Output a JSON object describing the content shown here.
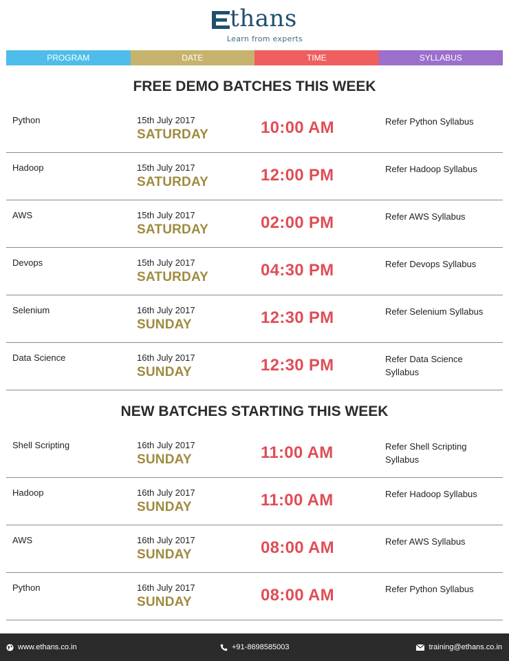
{
  "brand": {
    "name": "thans",
    "tagline": "Learn from experts"
  },
  "header": {
    "program": "PROGRAM",
    "date": "DATE",
    "time": "TIME",
    "syllabus": "SYLLABUS",
    "colors": {
      "program": "#4fbde9",
      "date": "#c7b36d",
      "time": "#ef5f5f",
      "syllabus": "#9b6fcc"
    }
  },
  "demo": {
    "title": "FREE DEMO BATCHES THIS WEEK",
    "rows": [
      {
        "program": "Python",
        "date": "15th July 2017",
        "day": "SATURDAY",
        "time": "10:00 AM",
        "syllabus": "Refer Python Syllabus"
      },
      {
        "program": "Hadoop",
        "date": "15th July 2017",
        "day": "SATURDAY",
        "time": "12:00 PM",
        "syllabus": "Refer Hadoop Syllabus"
      },
      {
        "program": "AWS",
        "date": "15th July 2017",
        "day": "SATURDAY",
        "time": "02:00 PM",
        "syllabus": "Refer AWS Syllabus"
      },
      {
        "program": "Devops",
        "date": "15th July 2017",
        "day": "SATURDAY",
        "time": "04:30 PM",
        "syllabus": "Refer Devops Syllabus"
      },
      {
        "program": "Selenium",
        "date": "16th July 2017",
        "day": "SUNDAY",
        "time": "12:30 PM",
        "syllabus": "Refer Selenium Syllabus"
      },
      {
        "program": "Data Science",
        "date": "16th July 2017",
        "day": "SUNDAY",
        "time": "12:30 PM",
        "syllabus": "Refer Data Science Syllabus"
      }
    ]
  },
  "new_batches": {
    "title": "NEW BATCHES STARTING THIS WEEK",
    "rows": [
      {
        "program": "Shell Scripting",
        "date": "16th July 2017",
        "day": "SUNDAY",
        "time": "11:00 AM",
        "syllabus": "Refer Shell Scripting Syllabus"
      },
      {
        "program": "Hadoop",
        "date": "16th July 2017",
        "day": "SUNDAY",
        "time": "11:00 AM",
        "syllabus": "Refer Hadoop Syllabus"
      },
      {
        "program": "AWS",
        "date": "16th July 2017",
        "day": "SUNDAY",
        "time": "08:00 AM",
        "syllabus": "Refer AWS Syllabus"
      },
      {
        "program": "Python",
        "date": "16th July 2017",
        "day": "SUNDAY",
        "time": "08:00 AM",
        "syllabus": "Refer Python Syllabus"
      }
    ]
  },
  "footer": {
    "website": "www.ethans.co.in",
    "phone": "+91-8698585003",
    "email": "training@ethans.co.in",
    "icons": {
      "website": "globe-icon",
      "phone": "phone-icon",
      "email": "envelope-icon"
    }
  },
  "colors": {
    "day": "#a08a3f",
    "time": "#df4e56",
    "brand": "#1f4f6e",
    "footer_bg": "#2b2b2b"
  }
}
